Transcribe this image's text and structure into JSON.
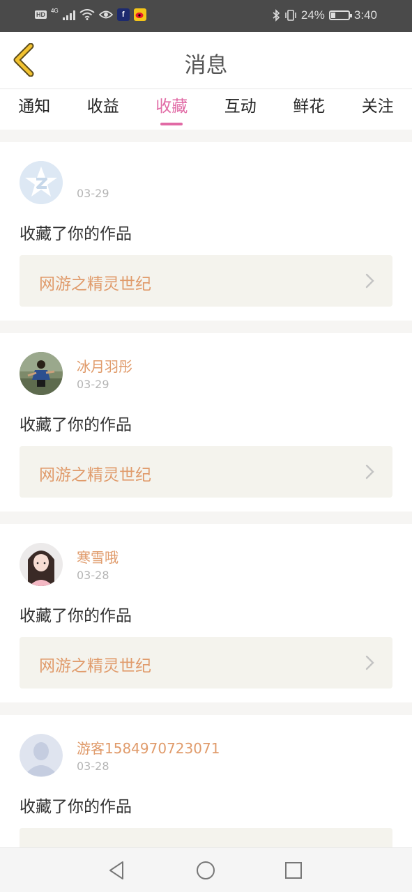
{
  "status_bar": {
    "hd": "HD",
    "network": "4G",
    "battery_percent": "24%",
    "battery_level": 0.24,
    "time": "3:40",
    "icons": [
      "signal-icon",
      "wifi-icon",
      "eye-icon",
      "app-icon-f",
      "weibo-icon",
      "bluetooth-icon",
      "vibrate-icon",
      "battery-icon"
    ]
  },
  "header": {
    "title": "消息",
    "back_icon": "chevron-left-icon",
    "accent_color": "#f2c230"
  },
  "tabs": [
    {
      "label": "通知",
      "active": false
    },
    {
      "label": "收益",
      "active": false
    },
    {
      "label": "收藏",
      "active": true
    },
    {
      "label": "互动",
      "active": false
    },
    {
      "label": "鲜花",
      "active": false
    },
    {
      "label": "关注",
      "active": false
    }
  ],
  "messages": [
    {
      "username": "",
      "date": "03-29",
      "action": "收藏了你的作品",
      "work_title": "网游之精灵世纪",
      "avatar": "qq-star-avatar"
    },
    {
      "username": "冰月羽彤",
      "date": "03-29",
      "action": "收藏了你的作品",
      "work_title": "网游之精灵世纪",
      "avatar": "photo-avatar"
    },
    {
      "username": "寒雪哦",
      "date": "03-28",
      "action": "收藏了你的作品",
      "work_title": "网游之精灵世纪",
      "avatar": "photo-avatar"
    },
    {
      "username": "游客1584970723071",
      "date": "03-28",
      "action": "收藏了你的作品",
      "work_title": "",
      "avatar": "default-user-avatar"
    }
  ],
  "colors": {
    "tab_active": "#e16aa5",
    "username": "#e09b6b",
    "work_title": "#e09b6b"
  },
  "nav": [
    "back-triangle-icon",
    "home-circle-icon",
    "recents-square-icon"
  ]
}
